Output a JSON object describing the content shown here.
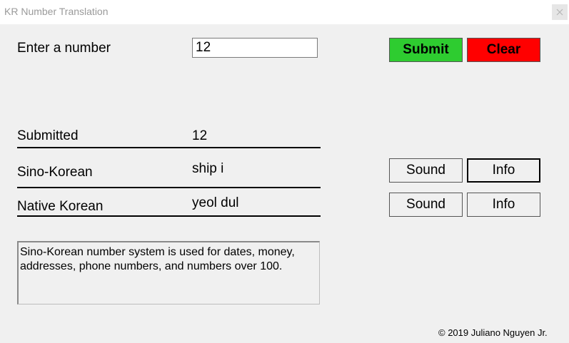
{
  "window": {
    "title": "KR Number Translation",
    "close_glyph": "×"
  },
  "input": {
    "label": "Enter a number",
    "value": "12"
  },
  "buttons": {
    "submit": "Submit",
    "clear": "Clear",
    "sound": "Sound",
    "info": "Info"
  },
  "results": {
    "submitted_label": "Submitted",
    "submitted_value": "12",
    "sino_label": "Sino-Korean",
    "sino_value": "ship i",
    "native_label": "Native Korean",
    "native_value": "yeol dul"
  },
  "info_text": "Sino-Korean number system is used for dates, money, addresses, phone numbers, and numbers over 100.",
  "footer": {
    "copyright": "© 2019 Juliano Nguyen Jr."
  },
  "colors": {
    "submit_bg": "#2ecc30",
    "clear_bg": "#ff0000",
    "window_bg": "#f0f0f0"
  }
}
